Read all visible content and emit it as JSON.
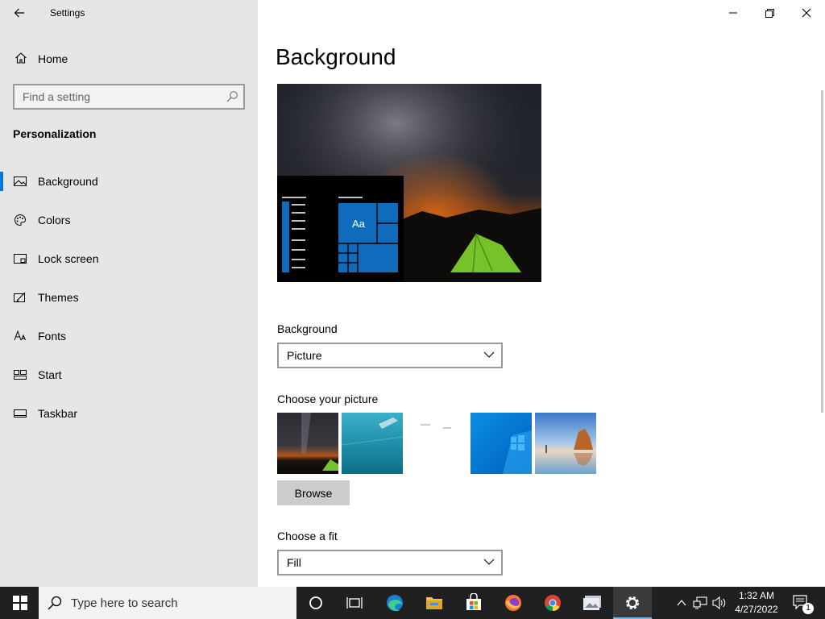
{
  "window": {
    "title": "Settings",
    "controls": {
      "minimize": "minimize",
      "restore": "restore",
      "close": "close"
    }
  },
  "sidebar": {
    "home_label": "Home",
    "search_placeholder": "Find a setting",
    "section_title": "Personalization",
    "items": [
      {
        "label": "Background",
        "icon": "picture-icon",
        "active": true
      },
      {
        "label": "Colors",
        "icon": "palette-icon",
        "active": false
      },
      {
        "label": "Lock screen",
        "icon": "lock-screen-icon",
        "active": false
      },
      {
        "label": "Themes",
        "icon": "themes-icon",
        "active": false
      },
      {
        "label": "Fonts",
        "icon": "fonts-icon",
        "active": false
      },
      {
        "label": "Start",
        "icon": "start-icon",
        "active": false
      },
      {
        "label": "Taskbar",
        "icon": "taskbar-icon",
        "active": false
      }
    ]
  },
  "main": {
    "title": "Background",
    "preview": {
      "tile_text": "Aa"
    },
    "background_label": "Background",
    "background_value": "Picture",
    "choose_picture_label": "Choose your picture",
    "pictures": [
      "milky-way-tent",
      "underwater-swimmer",
      "blank-white",
      "windows-blue",
      "beach-rocks"
    ],
    "browse_label": "Browse",
    "fit_label": "Choose a fit",
    "fit_value": "Fill"
  },
  "taskbar": {
    "search_placeholder": "Type here to search",
    "apps": [
      "cortana-icon",
      "task-view-icon",
      "edge-icon",
      "file-explorer-icon",
      "store-icon",
      "firefox-icon",
      "chrome-icon",
      "photos-icon",
      "settings-icon"
    ],
    "time": "1:32 AM",
    "date": "4/27/2022",
    "notification_count": "1"
  },
  "colors": {
    "accent": "#0078d7",
    "sidebar_bg": "#e6e6e6",
    "taskbar_bg": "#202020"
  }
}
